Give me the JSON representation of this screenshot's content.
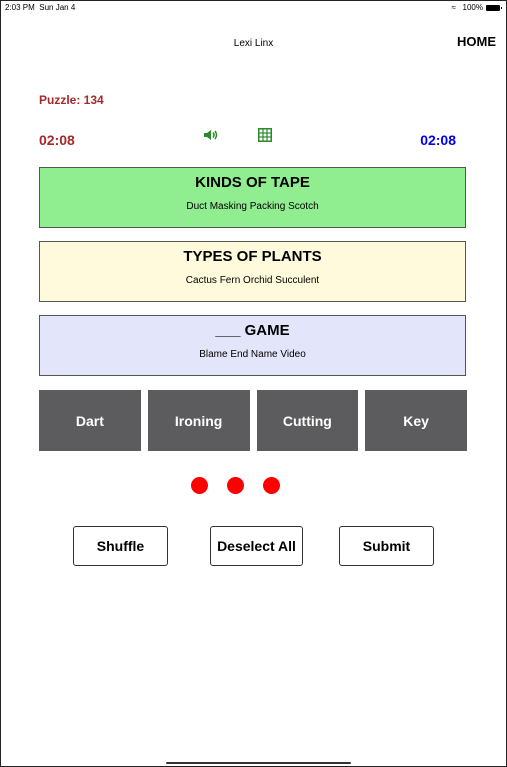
{
  "status_bar": {
    "time": "2:03 PM",
    "date": "Sun Jan 4",
    "battery": "100%"
  },
  "header": {
    "title": "Lexi Linx",
    "home_label": "HOME"
  },
  "puzzle": {
    "label": "Puzzle: 134"
  },
  "timers": {
    "left": "02:08",
    "right": "02:08"
  },
  "icons": {
    "sound": "speaker-icon",
    "grid": "grid-icon"
  },
  "solved_groups": [
    {
      "title": "KINDS OF TAPE",
      "words": "Duct  Masking  Packing  Scotch",
      "color": "#90ee90"
    },
    {
      "title": "TYPES OF PLANTS",
      "words": "Cactus  Fern  Orchid  Succulent",
      "color": "#fffadc"
    },
    {
      "title": "___ GAME",
      "words": "Blame  End  Name  Video",
      "color": "#e3e5fa"
    }
  ],
  "tiles": [
    "Dart",
    "Ironing",
    "Cutting",
    "Key"
  ],
  "mistakes_remaining": 3,
  "buttons": {
    "shuffle": "Shuffle",
    "deselect_all": "Deselect All",
    "submit": "Submit"
  },
  "colors": {
    "puzzle_red": "#a52a2a",
    "timer_blue": "#0000ee",
    "tile_gray": "#5c5c5e",
    "mistake_red": "#ff0000"
  }
}
